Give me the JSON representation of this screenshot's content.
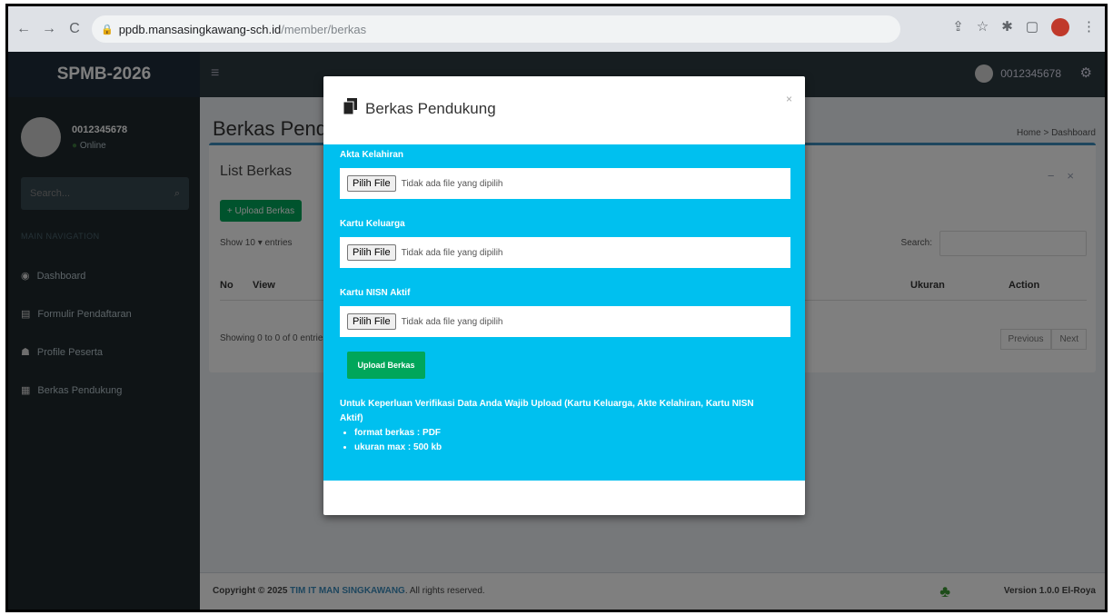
{
  "browser": {
    "nav": {
      "back": "←",
      "forward": "→",
      "reload": "C"
    },
    "url_host": "ppdb.mansasingkawang-sch.id",
    "url_path": "/member/berkas"
  },
  "app": {
    "logo": "SPMB-2026",
    "username": "0012345678",
    "status": "Online",
    "search_placeholder": "Search...",
    "menu_header": "MAIN NAVIGATION",
    "menu": [
      "Dashboard",
      "Formulir Pendaftaran",
      "Profile Peserta",
      "Berkas Pendukung"
    ]
  },
  "content": {
    "page_title": "Berkas Pendukung",
    "breadcrumb": "Home > Dashboard",
    "box_title": "List Berkas",
    "upload_button": "+ Upload Berkas",
    "show_label": "Show  10  ▾ entries",
    "search_label": "Search:",
    "columns": [
      "No",
      "View",
      "Ukuran",
      "Action"
    ],
    "showing": "Showing 0 to 0 of 0 entries",
    "pager": [
      "Previous",
      "Next"
    ]
  },
  "footer": {
    "copyright_prefix": "Copyright © 2025",
    "copyright_link": "TIM IT MAN SINGKAWANG",
    "copyright_suffix": ". All rights reserved.",
    "version": "Version 1.0.0 El-Roya"
  },
  "modal": {
    "title": "Berkas Pendukung",
    "close": "×",
    "fields": [
      {
        "label": "Akta Kelahiran",
        "button": "Pilih File",
        "value": "Tidak ada file yang dipilih"
      },
      {
        "label": "Kartu Keluarga",
        "button": "Pilih File",
        "value": "Tidak ada file yang dipilih"
      },
      {
        "label": "Kartu NISN Aktif",
        "button": "Pilih File",
        "value": "Tidak ada file yang dipilih"
      }
    ],
    "submit": "Upload Berkas",
    "notice": "Untuk Keperluan Verifikasi Data Anda Wajib Upload (Kartu Keluarga, Akte Kelahiran, Kartu NISN Aktif)",
    "rules": [
      "format berkas : PDF",
      "ukuran max : 500 kb"
    ]
  }
}
